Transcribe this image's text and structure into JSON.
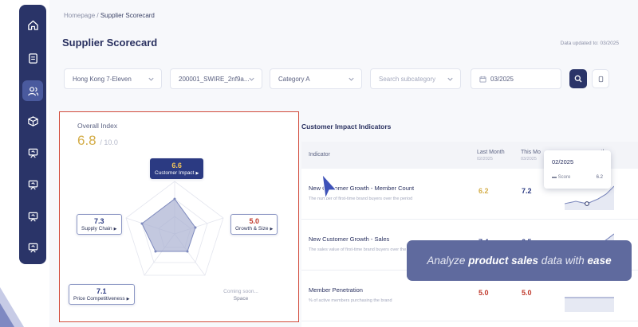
{
  "breadcrumb": {
    "home": "Homepage",
    "sep": "/",
    "current": "Supplier Scorecard"
  },
  "page": {
    "title": "Supplier Scorecard",
    "updated": "Data updated to: 03/2025"
  },
  "filters": {
    "store": "Hong Kong 7-Eleven",
    "supplier": "200001_SWIRE_2nf9a...",
    "category": "Category A",
    "subcategory_placeholder": "Search subcategory",
    "date": "03/2025"
  },
  "overall": {
    "title": "Overall Index",
    "score": "6.8",
    "max": "/ 10.0",
    "dimensions": [
      {
        "name": "Customer Impact",
        "value": "6.6"
      },
      {
        "name": "Growth & Size",
        "value": "5.0"
      },
      {
        "name": "Supply Chain",
        "value": "7.3"
      },
      {
        "name": "Price Competitiveness",
        "value": "7.1"
      }
    ],
    "coming_soon": "Coming soon...",
    "space_label": "Space"
  },
  "impact": {
    "title": "Customer Impact Indicators",
    "headers": {
      "indicator": "Indicator",
      "last_month": "Last Month",
      "last_month_sub": "02/2025",
      "this_month": "This Mo",
      "this_month_sub": "03/2025",
      "trend": "nths"
    },
    "rows": [
      {
        "name": "New Customer Growth - Member Count",
        "desc": "The number of first-time brand buyers over the period",
        "last": "6.2",
        "this": "7.2"
      },
      {
        "name": "New Customer Growth - Sales",
        "desc": "The sales value of first-time brand buyers over the period",
        "last": "7.4",
        "this": "6.5"
      },
      {
        "name": "Member Penetration",
        "desc": "% of active members purchasing the brand",
        "last": "5.0",
        "this": "5.0"
      }
    ]
  },
  "tooltip": {
    "date": "02/2025",
    "label": "Score",
    "value": "6.2"
  },
  "promo": {
    "pre": "Analyze ",
    "b1": "product sales",
    "mid": " data with ",
    "b2": "ease"
  },
  "colors": {
    "navy": "#2a3468",
    "gold": "#d4ad48",
    "red": "#c0392b",
    "accent_blue": "#2b3a82",
    "promo_bg": "#5f6a9e",
    "highlight_border": "#d24a3a"
  }
}
